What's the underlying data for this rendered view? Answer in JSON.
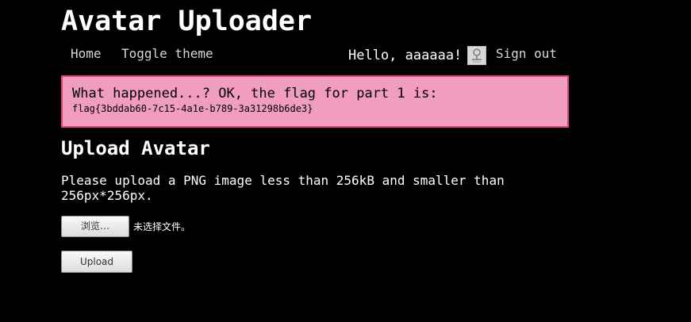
{
  "header": {
    "title": "Avatar Uploader"
  },
  "nav": {
    "home": "Home",
    "toggle_theme": "Toggle theme",
    "greeting": "Hello, aaaaaa!",
    "avatar_icon": "default-avatar-icon",
    "sign_out": "Sign out"
  },
  "flash": {
    "message": "What happened...? OK, the flag for part 1 is:",
    "flag": "flag{3bddab60-7c15-4a1e-b789-3a31298b6de3}",
    "background_color": "#f19dbf",
    "border_color": "#e4437a"
  },
  "upload": {
    "heading": "Upload Avatar",
    "instructions": "Please upload a PNG image less than 256kB and smaller than 256px*256px.",
    "browse_label": "浏览…",
    "file_status": "未选择文件。",
    "submit_label": "Upload"
  },
  "colors": {
    "page_background": "#000000",
    "text": "#ffffff"
  }
}
